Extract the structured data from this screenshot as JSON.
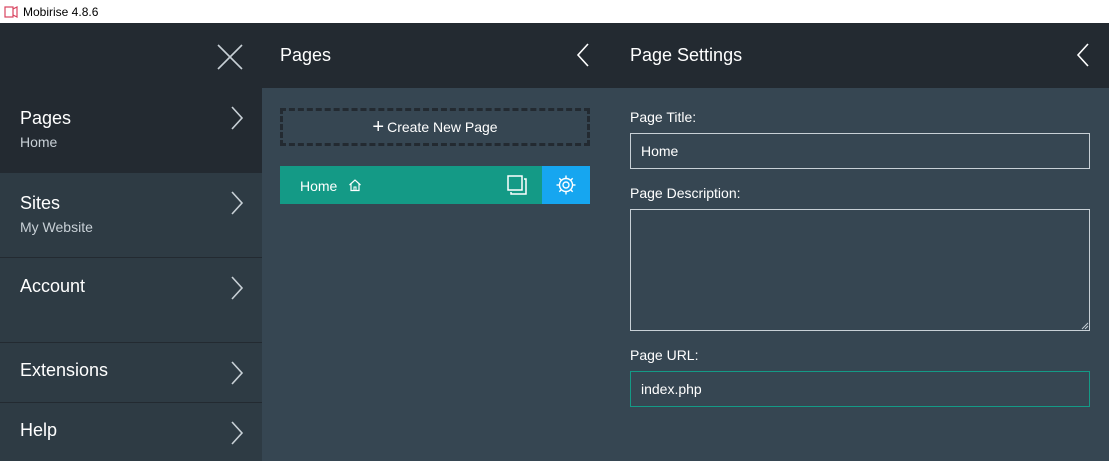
{
  "window": {
    "title": "Mobirise 4.8.6"
  },
  "nav": {
    "items": [
      {
        "label": "Pages",
        "sub": "Home"
      },
      {
        "label": "Sites",
        "sub": "My Website"
      },
      {
        "label": "Account"
      },
      {
        "label": "Extensions"
      },
      {
        "label": "Help"
      }
    ]
  },
  "pages_panel": {
    "title": "Pages",
    "create_label": "Create New Page",
    "pages": [
      {
        "name": "Home"
      }
    ]
  },
  "settings_panel": {
    "title": "Page Settings",
    "page_title_label": "Page Title:",
    "page_title_value": "Home",
    "page_description_label": "Page Description:",
    "page_description_value": "",
    "page_url_label": "Page URL:",
    "page_url_value": "index.php"
  },
  "colors": {
    "dark_header": "#232a31",
    "panel_bg": "#364652",
    "nav_bg": "#2e3b44",
    "page_teal": "#149a86",
    "gear_blue": "#16a6f0"
  },
  "icons": [
    "app-icon",
    "close-icon",
    "chevron-right-icon",
    "chevron-left-icon",
    "plus-icon",
    "home-icon",
    "duplicate-icon",
    "gear-icon"
  ]
}
